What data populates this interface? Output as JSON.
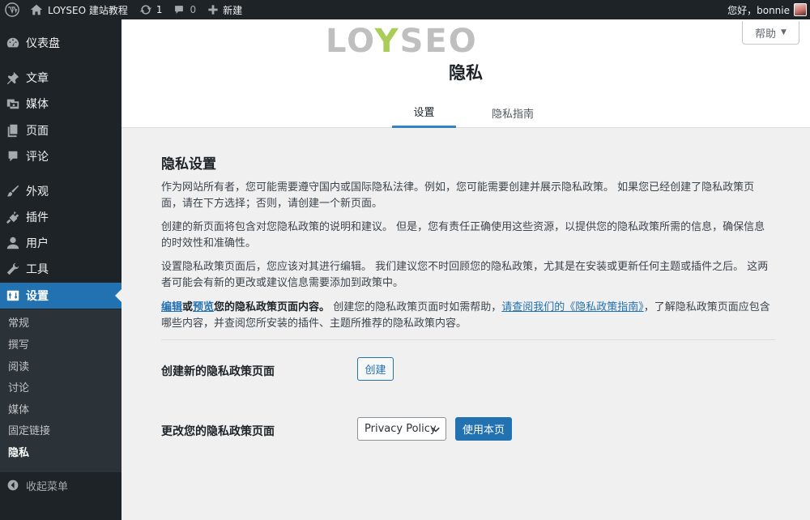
{
  "adminbar": {
    "site_name": "LOYSEO 建站教程",
    "updates_count": "1",
    "comments_count": "0",
    "new_label": "新建",
    "greeting": "您好，bonnie"
  },
  "sidebar": {
    "items": [
      {
        "label": "仪表盘",
        "icon": "dashboard-icon"
      },
      {
        "label": "文章",
        "icon": "pin-icon"
      },
      {
        "label": "媒体",
        "icon": "media-icon"
      },
      {
        "label": "页面",
        "icon": "page-icon"
      },
      {
        "label": "评论",
        "icon": "comment-icon"
      },
      {
        "label": "外观",
        "icon": "brush-icon"
      },
      {
        "label": "插件",
        "icon": "plugin-icon"
      },
      {
        "label": "用户",
        "icon": "user-icon"
      },
      {
        "label": "工具",
        "icon": "wrench-icon"
      },
      {
        "label": "设置",
        "icon": "settings-icon"
      }
    ],
    "submenu": [
      "常规",
      "撰写",
      "阅读",
      "讨论",
      "媒体",
      "固定链接",
      "隐私"
    ],
    "collapse_label": "收起菜单",
    "accent_color": "#2271b1"
  },
  "header": {
    "logo_text": "LOYSEO",
    "title": "隐私",
    "help_label": "帮助",
    "tabs": [
      "设置",
      "隐私指南"
    ]
  },
  "main": {
    "section_title": "隐私设置",
    "paragraph1": "作为网站所有者，您可能需要遵守国内或国际隐私法律。例如，您可能需要创建并展示隐私政策。 如果您已经创建了隐私政策页面，请在下方选择；否则，请创建一个新页面。",
    "paragraph2": "创建的新页面将包含对您隐私政策的说明和建议。 但是，您有责任正确使用这些资源，以提供您的隐私政策所需的信息，确保信息的时效性和准确性。",
    "paragraph3": "设置隐私政策页面后，您应该对其进行编辑。 我们建议您不时回顾您的隐私政策，尤其是在安装或更新任何主题或插件之后。 这两者可能会有新的更改或建议信息需要添加到政策中。",
    "p4_edit": "编辑",
    "p4_or": "或",
    "p4_preview": "预览",
    "p4_bold": "您的隐私政策页面内容。",
    "p4_text1": " 创建您的隐私政策页面时如需帮助，",
    "p4_link": "请查阅我们的《隐私政策指南》",
    "p4_text2": "，了解隐私政策页面应包含哪些内容，并查阅您所安装的插件、主题所推荐的隐私政策内容。",
    "create_label": "创建新的隐私政策页面",
    "create_button": "创建",
    "change_label": "更改您的隐私政策页面",
    "select_value": "Privacy Policy",
    "use_button": "使用本页"
  }
}
